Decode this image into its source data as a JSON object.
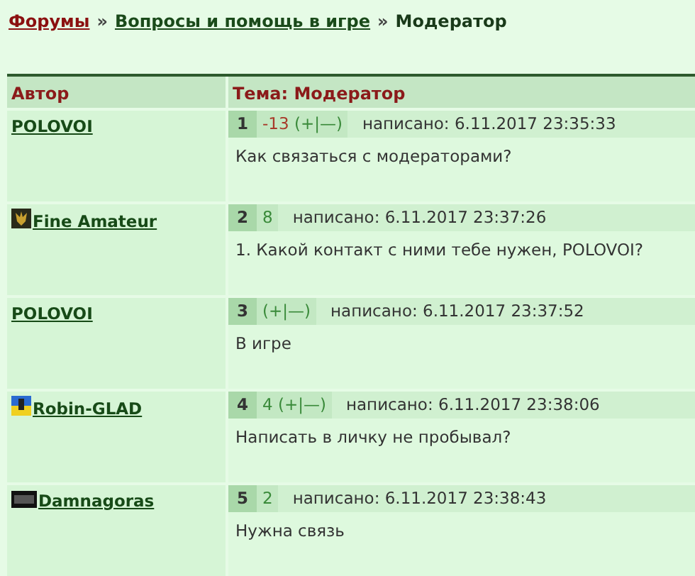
{
  "breadcrumb": [
    {
      "label": "Форумы",
      "kind": "root"
    },
    {
      "label": "»",
      "kind": "sep"
    },
    {
      "label": "Вопросы и помощь в игре",
      "kind": "link"
    },
    {
      "label": "»",
      "kind": "sep"
    },
    {
      "label": "Модератор",
      "kind": "current"
    }
  ],
  "table": {
    "columns": [
      "Автор",
      "Тема: Модератор"
    ],
    "posts": [
      {
        "author": "POLOVOI",
        "number": "1",
        "score": {
          "text": "-13",
          "color": "#a83a2a"
        },
        "vote": "(+|—)",
        "date": "написано: 6.11.2017 23:35:33",
        "text": "Как связаться с модераторами?"
      },
      {
        "author": "Fine Amateur",
        "avatar": {
          "kind": "trident"
        },
        "number": "2",
        "score": {
          "text": "8",
          "color": "#3a8a3a"
        },
        "date": "написано: 6.11.2017 23:37:26",
        "text": "1. Какой контакт с ними тебе нужен, POLOVOI?"
      },
      {
        "author": "POLOVOI",
        "number": "3",
        "vote": "(+|—)",
        "date": "написано: 6.11.2017 23:37:52",
        "text": "В игре"
      },
      {
        "author": "Robin-GLAD",
        "avatar": {
          "kind": "flag"
        },
        "number": "4",
        "score": {
          "text": "4",
          "color": "#3a8a3a"
        },
        "vote": "(+|—)",
        "date": "написано: 6.11.2017 23:38:06",
        "text": "Написать в личку не пробывал?"
      },
      {
        "author": "Damnagoras",
        "avatar": {
          "kind": "square"
        },
        "number": "5",
        "score": {
          "text": "2",
          "color": "#3a8a3a"
        },
        "date": "написано: 6.11.2017 23:38:43",
        "text": "Нужна связь"
      }
    ]
  }
}
